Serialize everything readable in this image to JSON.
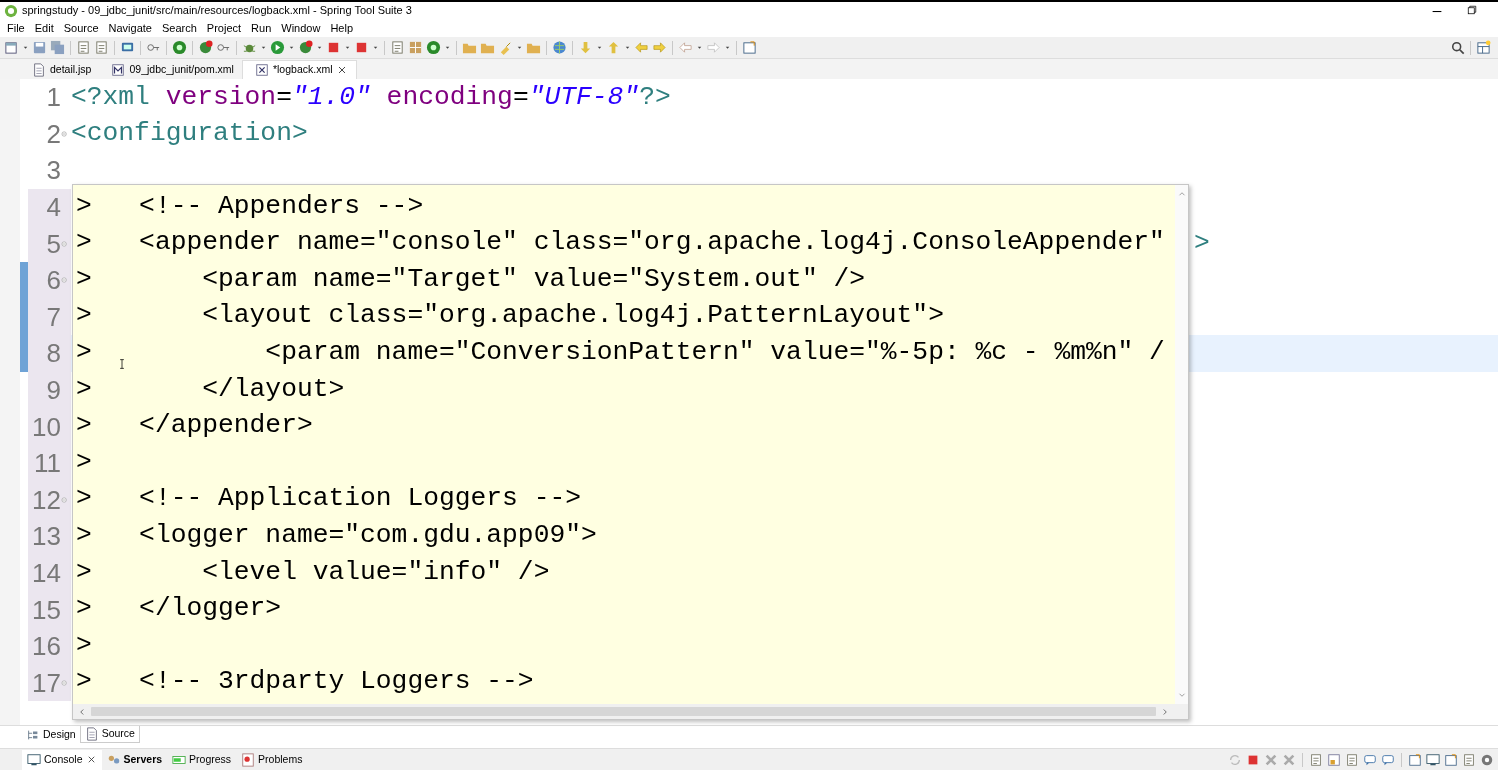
{
  "window": {
    "title": "springstudy - 09_jdbc_junit/src/main/resources/logback.xml - Spring Tool Suite 3"
  },
  "menu": [
    "File",
    "Edit",
    "Source",
    "Navigate",
    "Search",
    "Project",
    "Run",
    "Window",
    "Help"
  ],
  "editor_tabs": [
    {
      "label": "detail.jsp",
      "selected": false,
      "closable": false
    },
    {
      "label": "09_jdbc_junit/pom.xml",
      "selected": false,
      "closable": false
    },
    {
      "label": "*logback.xml",
      "selected": true,
      "closable": true
    }
  ],
  "editor": {
    "lines": [
      {
        "number": "1",
        "foldable": false,
        "changed": false,
        "current": false,
        "tokens": [
          {
            "kind": "tag",
            "text": "<?xml"
          },
          {
            "kind": "attr",
            "text": " version"
          },
          {
            "kind": "punct",
            "text": "="
          },
          {
            "kind": "string",
            "text": "\"1.0\""
          },
          {
            "kind": "attr",
            "text": " encoding"
          },
          {
            "kind": "punct",
            "text": "="
          },
          {
            "kind": "string",
            "text": "\"UTF-8\""
          },
          {
            "kind": "tag",
            "text": "?>"
          }
        ]
      },
      {
        "number": "2",
        "foldable": true,
        "changed": false,
        "current": false,
        "tokens": [
          {
            "kind": "tag",
            "text": "<configuration>"
          }
        ]
      },
      {
        "number": "3",
        "foldable": false,
        "changed": false,
        "current": false
      },
      {
        "number": "4",
        "foldable": false,
        "changed": false,
        "current": false
      },
      {
        "number": "5",
        "foldable": true,
        "changed": false,
        "current": false,
        "tokens": [
          {
            "kind": "tag",
            "text": ">"
          }
        ]
      },
      {
        "number": "6",
        "foldable": true,
        "changed": true,
        "current": false
      },
      {
        "number": "7",
        "foldable": false,
        "changed": true,
        "current": false
      },
      {
        "number": "8",
        "foldable": false,
        "changed": true,
        "current": true
      },
      {
        "number": "9",
        "foldable": false,
        "changed": false,
        "current": false
      },
      {
        "number": "10",
        "foldable": false,
        "changed": false,
        "current": false
      },
      {
        "number": "11",
        "foldable": false,
        "changed": false,
        "current": false
      },
      {
        "number": "12",
        "foldable": true,
        "changed": false,
        "current": false
      },
      {
        "number": "13",
        "foldable": false,
        "changed": false,
        "current": false
      },
      {
        "number": "14",
        "foldable": false,
        "changed": false,
        "current": false
      },
      {
        "number": "15",
        "foldable": false,
        "changed": false,
        "current": false
      },
      {
        "number": "16",
        "foldable": false,
        "changed": false,
        "current": false
      },
      {
        "number": "17",
        "foldable": true,
        "changed": false,
        "current": false
      }
    ],
    "hover": {
      "lines": [
        {
          "marker": ">",
          "text": "<!-- Appenders -->"
        },
        {
          "marker": ">",
          "text": "<appender name=\"console\" class=\"org.apache.log4j.ConsoleAppender\"",
          "children": [
            {
              "marker": ">",
              "text": "<param name=\"Target\" value=\"System.out\" />"
            },
            {
              "marker": ">",
              "text": "<layout class=\"org.apache.log4j.PatternLayout\">",
              "children": [
                {
                  "marker": ">",
                  "text": "<param name=\"ConversionPattern\" value=\"%-5p: %c - %m%n\" /"
                }
              ]
            },
            {
              "marker": ">",
              "text": "</layout>"
            }
          ]
        },
        {
          "marker": ">",
          "text": "</appender>"
        },
        {
          "marker": ">"
        },
        {
          "marker": ">",
          "text": "<!-- Application Loggers -->"
        },
        {
          "marker": ">",
          "text": "<logger name=\"com.gdu.app09\">",
          "children": [
            {
              "marker": ">",
              "text": "<level value=\"info\" />"
            }
          ]
        },
        {
          "marker": ">",
          "text": "</logger>"
        },
        {
          "marker": ">"
        },
        {
          "marker": ">",
          "text": "<!-- 3rdparty Loggers -->"
        }
      ]
    }
  },
  "editor_mode_tabs": [
    {
      "label": "Design",
      "selected": false
    },
    {
      "label": "Source",
      "selected": true
    }
  ],
  "view_tabs": [
    {
      "label": "Console",
      "selected": true,
      "bold": false,
      "closable": true
    },
    {
      "label": "Servers",
      "selected": false,
      "bold": true,
      "closable": false
    },
    {
      "label": "Progress",
      "selected": false,
      "bold": false,
      "closable": false
    },
    {
      "label": "Problems",
      "selected": false,
      "bold": false,
      "closable": false
    }
  ]
}
